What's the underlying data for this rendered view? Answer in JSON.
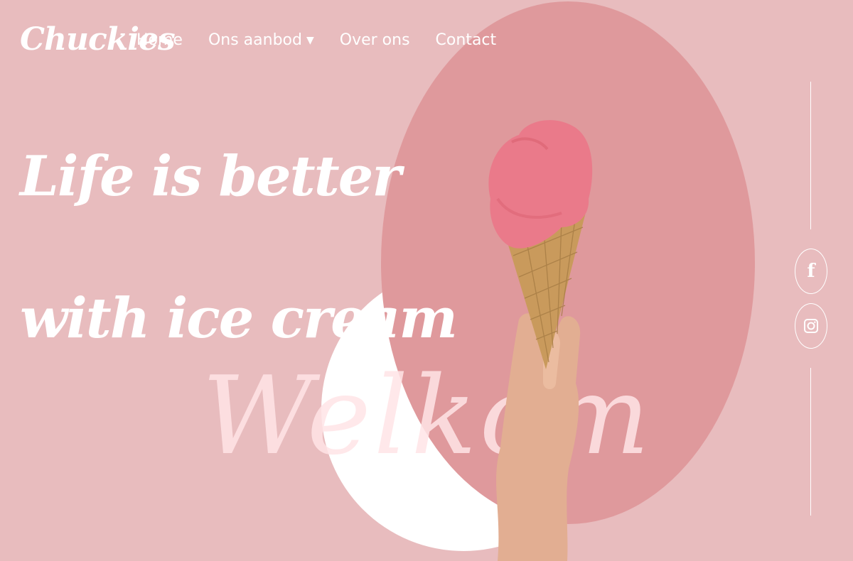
{
  "brand": {
    "logo": "Chuckies"
  },
  "nav": {
    "items": [
      {
        "label": "Home"
      },
      {
        "label": "Ons aanbod",
        "has_dropdown": true
      },
      {
        "label": "Over ons"
      },
      {
        "label": "Contact"
      }
    ]
  },
  "hero": {
    "line1": "Life is better",
    "line2": "with ice cream",
    "watermark": "Welkom"
  },
  "social": {
    "facebook_glyph": "f"
  },
  "icons": {
    "dropdown": "chevron-down-icon",
    "facebook": "facebook-icon",
    "instagram": "instagram-icon"
  },
  "colors": {
    "background": "#e8bcbe",
    "oval": "#df999c",
    "accent_white": "#ffffff",
    "ice_cream": "#ea7a8a",
    "cone": "#c99a5c"
  }
}
